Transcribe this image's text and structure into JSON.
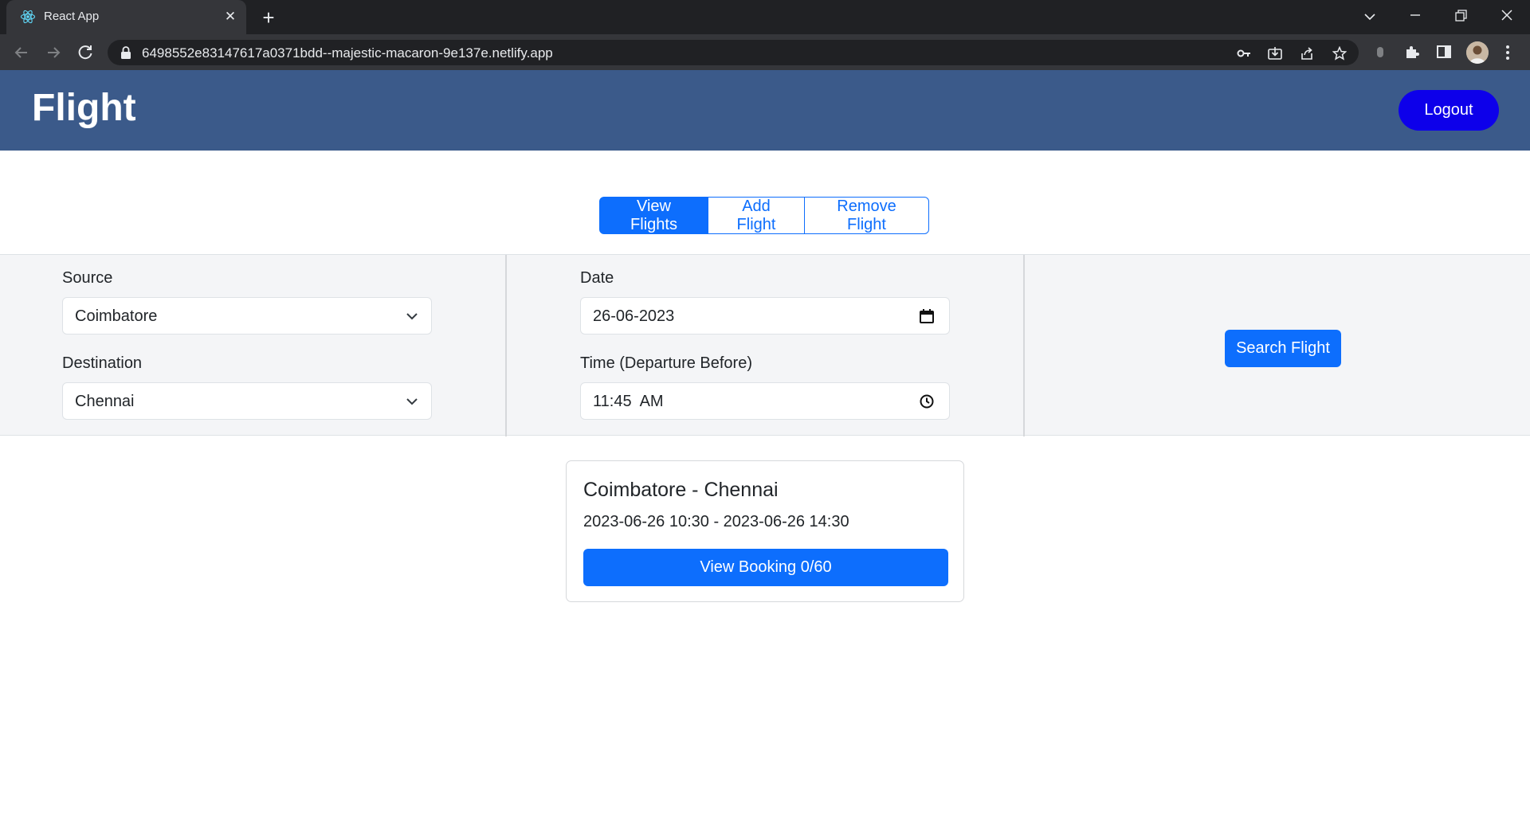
{
  "browser": {
    "tab_title": "React App",
    "url": "6498552e83147617a0371bdd--majestic-macaron-9e137e.netlify.app"
  },
  "navbar": {
    "brand": "Flight",
    "logout_label": "Logout"
  },
  "tabs": [
    {
      "label": "View Flights",
      "active": true
    },
    {
      "label": "Add Flight",
      "active": false
    },
    {
      "label": "Remove Flight",
      "active": false
    }
  ],
  "search": {
    "source_label": "Source",
    "source_value": "Coimbatore",
    "destination_label": "Destination",
    "destination_value": "Chennai",
    "date_label": "Date",
    "date_value": "26-06-2023",
    "time_label": "Time (Departure Before)",
    "time_value": "11:45  AM",
    "search_label": "Search Flight"
  },
  "results": [
    {
      "route": "Coimbatore - Chennai",
      "times": "2023-06-26 10:30 - 2023-06-26 14:30",
      "booking_label": "View Booking 0/60"
    }
  ],
  "colors": {
    "navbar": "#3b5a8a",
    "logout": "#0d00ea",
    "primary": "#0d6efd"
  }
}
